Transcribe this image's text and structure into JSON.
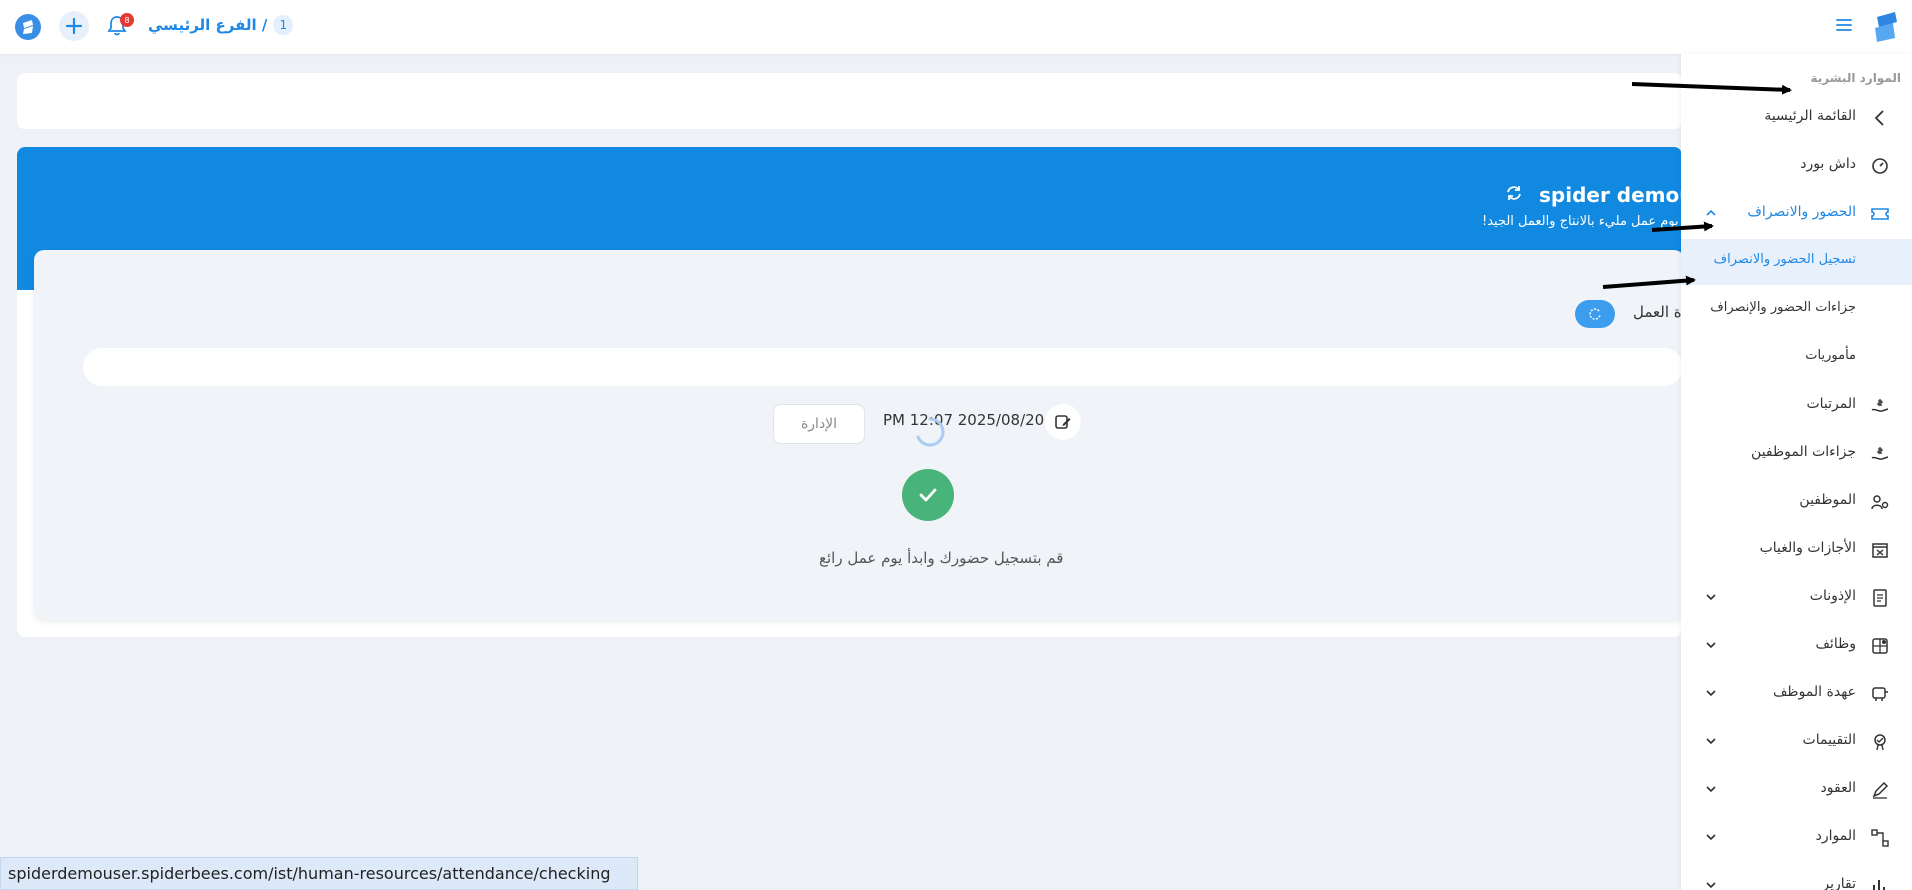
{
  "topbar": {
    "branch_number": "1",
    "branch_name": "الفرع الرئيسي /",
    "notification_count": "8"
  },
  "hero": {
    "title": "spider demou",
    "subtitle": "تمنى لك يوم عمل مليء بالانتاج والعمل الجيد!"
  },
  "attendance": {
    "work_label": "ة العمل",
    "datetime": "PM 12:07 2025/08/20",
    "admin_placeholder": "الإدارة",
    "message": "قم بتسجيل حضورك وابدأ يوم عمل رائع"
  },
  "sidebar": {
    "section_title": "الموارد البشرية",
    "items": [
      {
        "label": "القائمة الرئيسية",
        "icon": "chevron-left-icon"
      },
      {
        "label": "داش بورد",
        "icon": "gauge-icon"
      },
      {
        "label": "الحضور والانصراف",
        "icon": "ticket-icon",
        "active": true,
        "expanded": true
      },
      {
        "label": "تسجيل الحضور والانصراف",
        "sub": true,
        "active": true
      },
      {
        "label": "جزاءات الحضور والإنصراف",
        "sub": true
      },
      {
        "label": "مأموريات",
        "sub": true
      },
      {
        "label": "المرتبات",
        "icon": "hand-money-icon"
      },
      {
        "label": "جزاءات الموظفين",
        "icon": "hand-money-icon"
      },
      {
        "label": "الموظفين",
        "icon": "users-gear-icon"
      },
      {
        "label": "الأجازات والغياب",
        "icon": "calendar-x-icon"
      },
      {
        "label": "الإذونات",
        "icon": "document-list-icon",
        "collapsible": true
      },
      {
        "label": "وظائف",
        "icon": "grid-plus-icon",
        "collapsible": true
      },
      {
        "label": "عهدة الموظف",
        "icon": "cart-icon",
        "collapsible": true
      },
      {
        "label": "التقييمات",
        "icon": "badge-check-icon",
        "collapsible": true
      },
      {
        "label": "العقود",
        "icon": "pen-icon",
        "collapsible": true
      },
      {
        "label": "الموارد",
        "icon": "nodes-icon",
        "collapsible": true
      },
      {
        "label": "تقارير",
        "icon": "chart-icon",
        "collapsible": true
      }
    ]
  },
  "status_url": "spiderdemouser.spiderbees.com/ist/human-resources/attendance/checking",
  "colors": {
    "primary": "#1289e1",
    "accent_blue": "#1e88e5",
    "success": "#49b47a",
    "notification": "#e53935"
  }
}
